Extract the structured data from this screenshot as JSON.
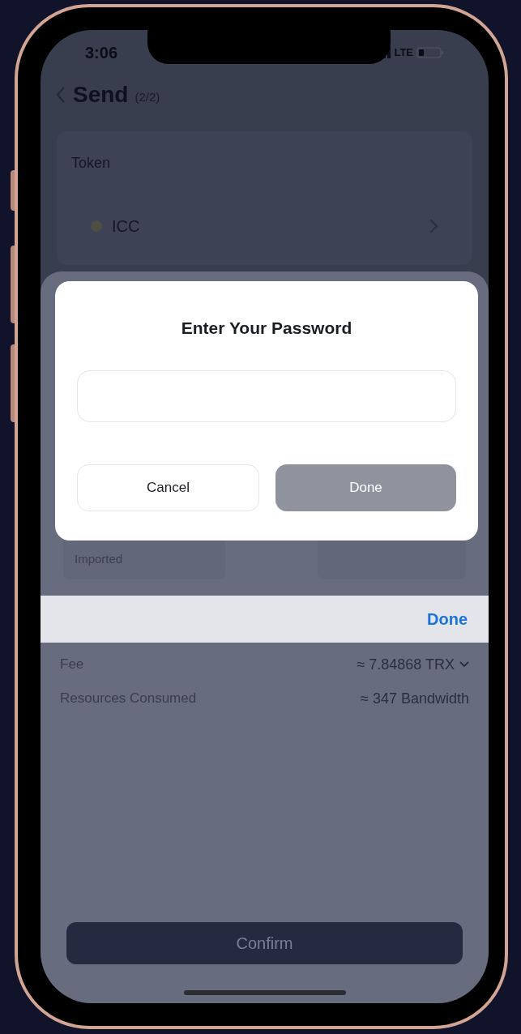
{
  "status_bar": {
    "time": "3:06",
    "network": "LTE"
  },
  "header": {
    "title": "Send",
    "step": "(2/2)"
  },
  "token": {
    "label": "Token",
    "symbol": "ICC"
  },
  "from": {
    "tag": "Imported"
  },
  "password_dialog": {
    "title": "Enter Your Password",
    "buttons": [
      {
        "label": "Cancel",
        "kind": "secondary"
      },
      {
        "label": "Done",
        "kind": "primary"
      }
    ]
  },
  "keyboard_toolbar": {
    "done": "Done"
  },
  "details": [
    {
      "label": "Fee",
      "value": "≈ 7.84868 TRX",
      "expandable": true
    },
    {
      "label": "Resources Consumed",
      "value": "≈ 347 Bandwidth",
      "expandable": false
    }
  ],
  "confirm": "Confirm"
}
